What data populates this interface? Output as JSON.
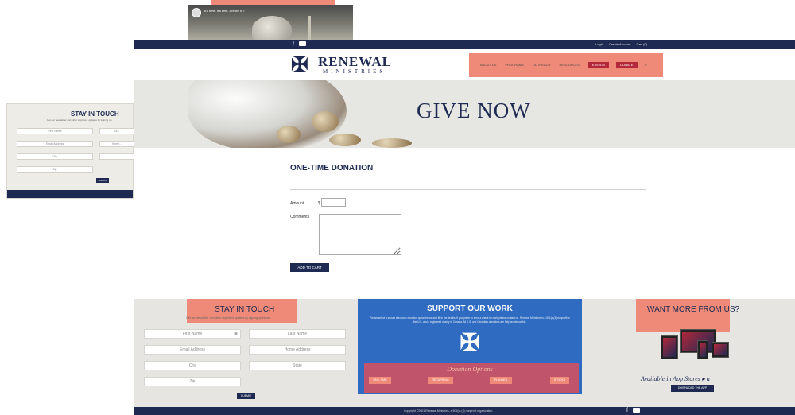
{
  "video": {
    "title": "It's time. It's time. Are we in?"
  },
  "side_card": {
    "title": "STAY IN TOUCH",
    "subtitle": "Get our newsletter and other important updates by signing up",
    "fields": [
      "First Name",
      "La...",
      "Email Address",
      "Home...",
      "City",
      "",
      "Zip"
    ],
    "submit": "SUBMIT"
  },
  "topbar": {
    "facebook": "f",
    "links": [
      "Login",
      "Create Account",
      "Cart (0)"
    ]
  },
  "logo": {
    "word1": "RENEWAL",
    "word2": "MINISTRIES"
  },
  "nav": {
    "items": [
      "ABOUT US",
      "PROGRAMS",
      "OUTREACH",
      "RESOURCES"
    ],
    "buttons": [
      "EVENTS",
      "DONATE"
    ]
  },
  "hero": {
    "title": "GIVE NOW"
  },
  "donation": {
    "heading": "ONE-TIME DONATION",
    "amount_label": "Amount",
    "currency": "$",
    "amount_value": "",
    "comments_label": "Comments",
    "comments_value": "",
    "cart_button": "ADD TO CART"
  },
  "footer": {
    "stay": {
      "title": "STAY IN TOUCH",
      "subtitle": "Get our newsletter and other important updates by signing up below",
      "first_name": "First Name",
      "last_name": "Last Name",
      "email": "Email Address",
      "home_address": "Home Address",
      "city": "City",
      "state": "State",
      "zip": "Zip",
      "submit": "SUBMIT"
    },
    "support": {
      "title": "SUPPORT OUR WORK",
      "text": "Please select a secure electronic donation option below and fill in the details. If you prefer to send a check by mail, please contact us. Renewal Ministries is a 501(c)(3) nonprofit in the U.S. and a registered charity in Canada. All U.S. and Canadian donations are fully tax-deductible.",
      "options_title": "Donation Options",
      "options": [
        "ONE-TIME",
        "RECURRING",
        "PLANNED",
        "STOCKS"
      ]
    },
    "more": {
      "title": "WANT MORE FROM US?",
      "available": "Available in App Stores",
      "store_icons": " ▸ a",
      "download": "DOWNLOAD THE APP"
    }
  },
  "bottombar": {
    "copyright": "Copyright ©2021 Renewal Ministries, a 501(c) (3) nonprofit organization.",
    "facebook": "f"
  }
}
